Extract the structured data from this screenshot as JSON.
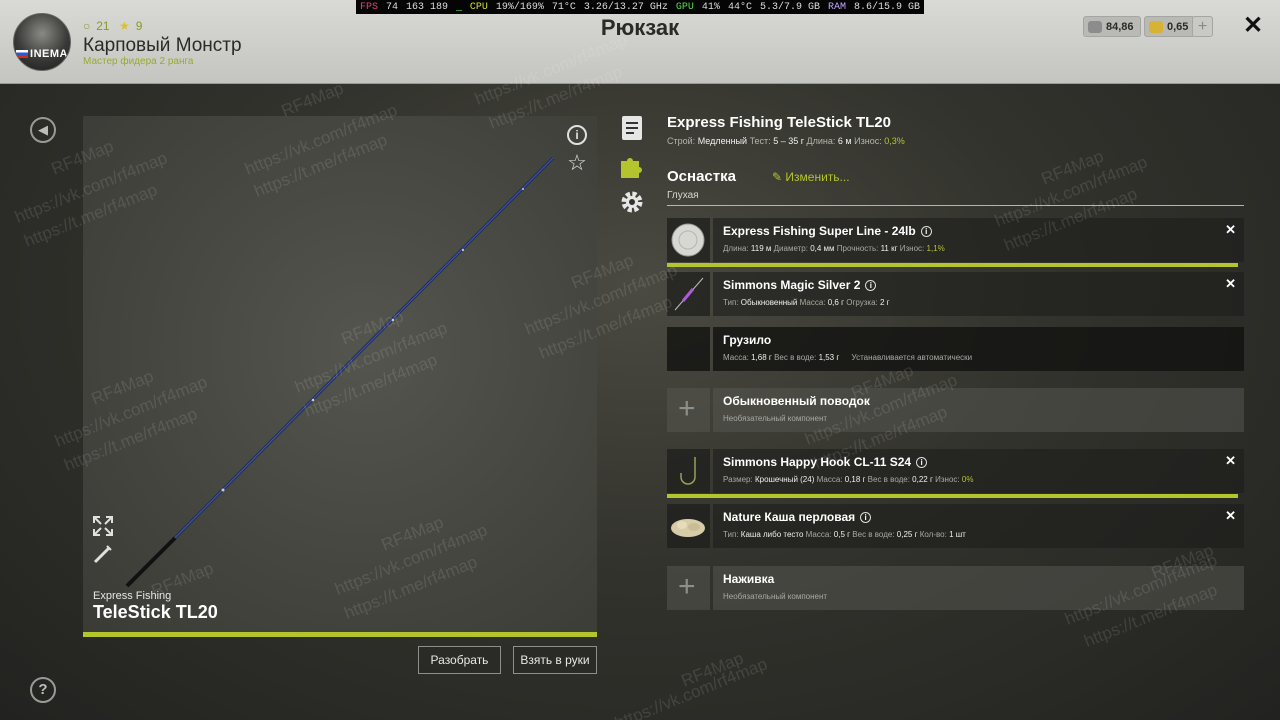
{
  "player": {
    "coins_count": "21",
    "stars_count": "9",
    "name": "Карповый Монстр",
    "rank": "Мастер фидера 2 ранга",
    "avatar_tag": "INEMA"
  },
  "header": {
    "title": "Рюкзак"
  },
  "hud": {
    "fps_label": "FPS",
    "fps_value": "74",
    "fps_sub": "163 189",
    "cpu_label": "CPU",
    "cpu_value": "19%/169%",
    "cpu_temp": "71°C",
    "cpu_clock": "3.26/13.27 GHz",
    "gpu_label": "GPU",
    "gpu_value": "41%",
    "gpu_temp": "44°C",
    "gpu_mem": "5.3/7.9 GB",
    "ram_label": "RAM",
    "ram_value": "8.6/15.9 GB"
  },
  "currency": {
    "silver": "84,86",
    "gold": "0,65",
    "add_label": "+",
    "silver_color": "#8c8c8c",
    "gold_color": "#d8b234"
  },
  "close_label": "✕",
  "rod": {
    "brand": "Express Fishing",
    "model": "TeleStick TL20",
    "full_name": "Express Fishing TeleStick TL20",
    "specs": {
      "action_label": "Строй:",
      "action": "Медленный",
      "test_label": "Тест:",
      "test": "5 – 35 г",
      "length_label": "Длина:",
      "length": "6 м",
      "wear_label": "Износ:",
      "wear": "0,3%"
    }
  },
  "actions": {
    "disassemble": "Разобрать",
    "take_in_hands": "Взять в руки"
  },
  "rig": {
    "title": "Оснастка",
    "subtitle": "Глухая",
    "edit_label": "Изменить..."
  },
  "slots": [
    {
      "name": "Express Fishing Super Line - 24lb",
      "details": [
        {
          "label": "Длина:",
          "value": "119 м"
        },
        {
          "label": "Диаметр:",
          "value": "0,4 мм"
        },
        {
          "label": "Прочность:",
          "value": "11 кг"
        },
        {
          "label": "Износ:",
          "value": "1,1%",
          "green": true
        }
      ],
      "thumb_text": "SUPER LINE",
      "removable": true,
      "bar": true
    },
    {
      "name": "Simmons Magic Silver 2",
      "details": [
        {
          "label": "Тип:",
          "value": "Обыкновенный"
        },
        {
          "label": "Масса:",
          "value": "0,6 г"
        },
        {
          "label": "Огрузка:",
          "value": "2 г"
        }
      ],
      "removable": true,
      "bar": false
    },
    {
      "name": "Грузило",
      "details": [
        {
          "label": "Масса:",
          "value": "1,68 г"
        },
        {
          "label": "Вес в воде:",
          "value": "1,53 г"
        },
        {
          "label": "Устанавливается автоматически",
          "value": ""
        }
      ],
      "removable": false,
      "bar": false
    },
    {
      "name": "Обыкновенный поводок",
      "optional_label": "Необязательный компонент",
      "empty": true
    },
    {
      "name": "Simmons Happy Hook CL-11 S24",
      "details": [
        {
          "label": "Размер:",
          "value": "Крошечный (24)"
        },
        {
          "label": "Масса:",
          "value": "0,18 г"
        },
        {
          "label": "Вес в воде:",
          "value": "0,22 г"
        },
        {
          "label": "Износ:",
          "value": "0%",
          "green": true
        }
      ],
      "removable": true,
      "bar": true
    },
    {
      "name": "Nature Каша перловая",
      "details": [
        {
          "label": "Тип:",
          "value": "Каша либо тесто"
        },
        {
          "label": "Масса:",
          "value": "0,5 г"
        },
        {
          "label": "Вес в воде:",
          "value": "0,25 г"
        },
        {
          "label": "Кол-во:",
          "value": "1 шт"
        }
      ],
      "removable": true,
      "bar": false
    },
    {
      "name": "Наживка",
      "optional_label": "Необязательный компонент",
      "empty": true
    }
  ],
  "watermarks": {
    "site": "RF4Map",
    "vk": "https://vk.com/rf4map",
    "tg": "https://t.me/rf4map"
  },
  "accent_color": "#b3c42c"
}
